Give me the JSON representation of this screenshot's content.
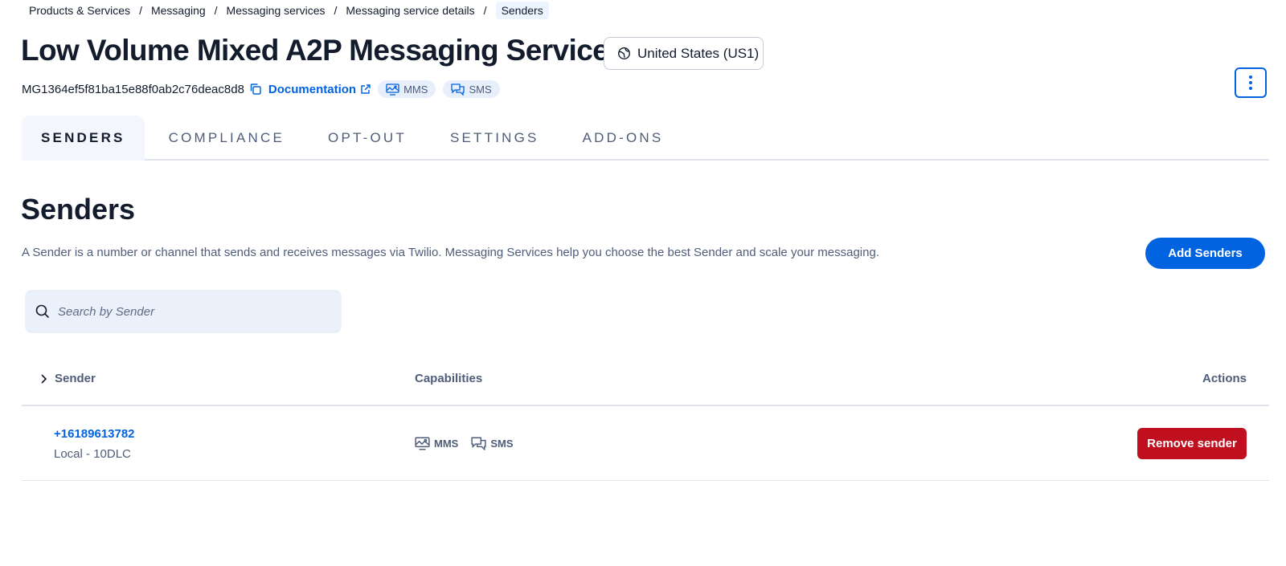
{
  "breadcrumb": {
    "items": [
      "Products & Services",
      "Messaging",
      "Messaging services",
      "Messaging service details"
    ],
    "current": "Senders",
    "separator": "/"
  },
  "header": {
    "title": "Low Volume Mixed A2P Messaging Service",
    "region": "United States (US1)",
    "service_sid": "MG1364ef5f81ba15e88f0ab2c76deac8d8",
    "documentation_label": "Documentation",
    "badges": [
      "MMS",
      "SMS"
    ]
  },
  "tabs": [
    {
      "label": "SENDERS",
      "active": true
    },
    {
      "label": "COMPLIANCE",
      "active": false
    },
    {
      "label": "OPT-OUT",
      "active": false
    },
    {
      "label": "SETTINGS",
      "active": false
    },
    {
      "label": "ADD-ONS",
      "active": false
    }
  ],
  "senders_section": {
    "title": "Senders",
    "description": "A Sender is a number or channel that sends and receives messages via Twilio. Messaging Services help you choose the best Sender and scale your messaging.",
    "add_button_label": "Add Senders",
    "search_placeholder": "Search by Sender"
  },
  "table": {
    "columns": [
      "Sender",
      "Capabilities",
      "Actions"
    ],
    "rows": [
      {
        "sender": "+16189613782",
        "type": "Local - 10DLC",
        "capabilities": [
          "MMS",
          "SMS"
        ],
        "action_label": "Remove sender"
      }
    ]
  },
  "colors": {
    "primary": "#0263e0",
    "destructive": "#c0101f",
    "text": "#121c2d",
    "muted_text": "#4f5d7a",
    "badge_bg": "#e6effb"
  }
}
